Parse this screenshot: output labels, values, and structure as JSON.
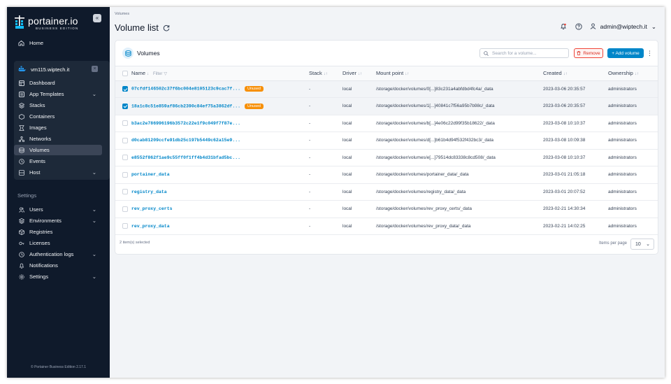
{
  "sidebar": {
    "brand_name": "portainer.io",
    "brand_edition": "BUSINESS EDITION",
    "home_label": "Home",
    "environment": {
      "name": "vm115.wiptech.it",
      "close_label": "×",
      "items": [
        {
          "label": "Dashboard",
          "icon": "dashboard-icon"
        },
        {
          "label": "App Templates",
          "icon": "template-icon",
          "expandable": true
        },
        {
          "label": "Stacks",
          "icon": "stacks-icon"
        },
        {
          "label": "Containers",
          "icon": "containers-icon"
        },
        {
          "label": "Images",
          "icon": "images-icon"
        },
        {
          "label": "Networks",
          "icon": "networks-icon"
        },
        {
          "label": "Volumes",
          "icon": "volumes-icon",
          "active": true
        },
        {
          "label": "Events",
          "icon": "events-icon"
        },
        {
          "label": "Host",
          "icon": "host-icon",
          "expandable": true
        }
      ]
    },
    "settings_heading": "Settings",
    "settings_items": [
      {
        "label": "Users",
        "icon": "users-icon",
        "expandable": true
      },
      {
        "label": "Environments",
        "icon": "environments-icon",
        "expandable": true
      },
      {
        "label": "Registries",
        "icon": "registries-icon"
      },
      {
        "label": "Licenses",
        "icon": "licenses-icon"
      },
      {
        "label": "Authentication logs",
        "icon": "auth-logs-icon",
        "expandable": true
      },
      {
        "label": "Notifications",
        "icon": "notifications-icon"
      },
      {
        "label": "Settings",
        "icon": "settings-icon",
        "expandable": true
      }
    ],
    "footer": "© Portainer Business Edition 2.17.1"
  },
  "header": {
    "breadcrumb": "Volumes",
    "title": "Volume list",
    "user": "admin@wiptech.it"
  },
  "card": {
    "title": "Volumes",
    "search_placeholder": "Search for a volume...",
    "remove_label": "Remove",
    "add_label": "+ Add volume",
    "columns": {
      "name": "Name",
      "filter": "Filter",
      "stack": "Stack",
      "driver": "Driver",
      "mount": "Mount point",
      "created": "Created",
      "ownership": "Ownership"
    },
    "rows": [
      {
        "name": "07cfdf146502c37f6bc004e8105123c9cac7f...",
        "unused": "Unused",
        "stack": "-",
        "driver": "local",
        "mount": "/storage/docker/volumes/0[...]83c231a4abfdbd4fc4a/_data",
        "created": "2023-03-06 20:35:57",
        "ownership": "administrators",
        "selected": true
      },
      {
        "name": "18a1c8c51e859af86cb2390c84ef75a3862df...",
        "unused": "Unused",
        "stack": "-",
        "driver": "local",
        "mount": "/storage/docker/volumes/1[...]40841c7f56a95b7b98c/_data",
        "created": "2023-03-06 20:35:57",
        "ownership": "administrators",
        "selected": true
      },
      {
        "name": "b3ac2e786996196b3572c22e1f9c049f7f87e...",
        "unused": "",
        "stack": "-",
        "driver": "local",
        "mount": "/storage/docker/volumes/b[...]4e06c22d99f35b18622/_data",
        "created": "2023-03-08 10:10:37",
        "ownership": "administrators",
        "selected": false
      },
      {
        "name": "d0cab81209ccfe91db25c197b5449c62a15e9...",
        "unused": "",
        "stack": "-",
        "driver": "local",
        "mount": "/storage/docker/volumes/d[...]b61b4d94f532f432bc3/_data",
        "created": "2023-03-08 10:09:38",
        "ownership": "administrators",
        "selected": false
      },
      {
        "name": "e8552f862f1ae9c55ff0f1ff4b4d31bfad5bc...",
        "unused": "",
        "stack": "-",
        "driver": "local",
        "mount": "/storage/docker/volumes/e[...]79514dc83338c8cd508/_data",
        "created": "2023-03-08 10:10:37",
        "ownership": "administrators",
        "selected": false
      },
      {
        "name": "portainer_data",
        "unused": "",
        "stack": "-",
        "driver": "local",
        "mount": "/storage/docker/volumes/portainer_data/_data",
        "created": "2023-03-01 21:05:18",
        "ownership": "administrators",
        "selected": false
      },
      {
        "name": "registry_data",
        "unused": "",
        "stack": "-",
        "driver": "local",
        "mount": "/storage/docker/volumes/registry_data/_data",
        "created": "2023-03-01 20:07:52",
        "ownership": "administrators",
        "selected": false
      },
      {
        "name": "rev_proxy_certs",
        "unused": "",
        "stack": "-",
        "driver": "local",
        "mount": "/storage/docker/volumes/rev_proxy_certs/_data",
        "created": "2023-02-21 14:30:34",
        "ownership": "administrators",
        "selected": false
      },
      {
        "name": "rev_proxy_data",
        "unused": "",
        "stack": "-",
        "driver": "local",
        "mount": "/storage/docker/volumes/rev_proxy_data/_data",
        "created": "2023-02-21 14:02:25",
        "ownership": "administrators",
        "selected": false
      }
    ],
    "selected_text": "2 item(s) selected",
    "items_per_page_label": "Items per page",
    "items_per_page_value": "10"
  },
  "colors": {
    "sidebar_bg": "#0f1a2b",
    "accent": "#0086c9",
    "unused_badge": "#f79009",
    "danger": "#f04438"
  }
}
